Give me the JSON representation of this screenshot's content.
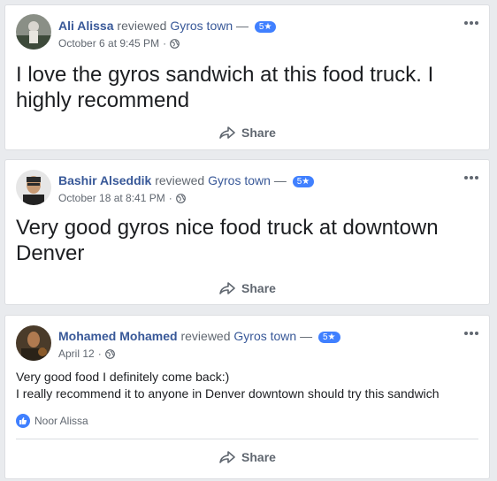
{
  "reviews": [
    {
      "author": "Ali Alissa",
      "verb": "reviewed",
      "place": "Gyros town",
      "dash": "—",
      "rating": "5★",
      "time": "October 6 at 9:45 PM",
      "sep": "·",
      "text": [
        "I love the gyros sandwich at this food truck. I",
        "highly recommend"
      ],
      "share": "Share"
    },
    {
      "author": "Bashir Alseddik",
      "verb": "reviewed",
      "place": "Gyros town",
      "dash": "—",
      "rating": "5★",
      "time": "October 18 at 8:41 PM",
      "sep": "·",
      "text": [
        "Very good gyros nice food truck at downtown",
        "Denver"
      ],
      "share": "Share"
    },
    {
      "author": "Mohamed Mohamed",
      "verb": "reviewed",
      "place": "Gyros town",
      "dash": "—",
      "rating": "5★",
      "time": "April 12",
      "sep": "·",
      "text": [
        "Very good food I definitely come back:)",
        "I really recommend it to anyone in Denver downtown should try this sandwich"
      ],
      "liked_by": "Noor Alissa",
      "share": "Share"
    }
  ],
  "colors": {
    "link": "#385898",
    "meta": "#606770",
    "badge": "#4080ff",
    "background": "#e9ebee"
  },
  "icons": [
    "globe-icon",
    "more-options-icon",
    "share-arrow-icon",
    "like-thumb-icon"
  ]
}
